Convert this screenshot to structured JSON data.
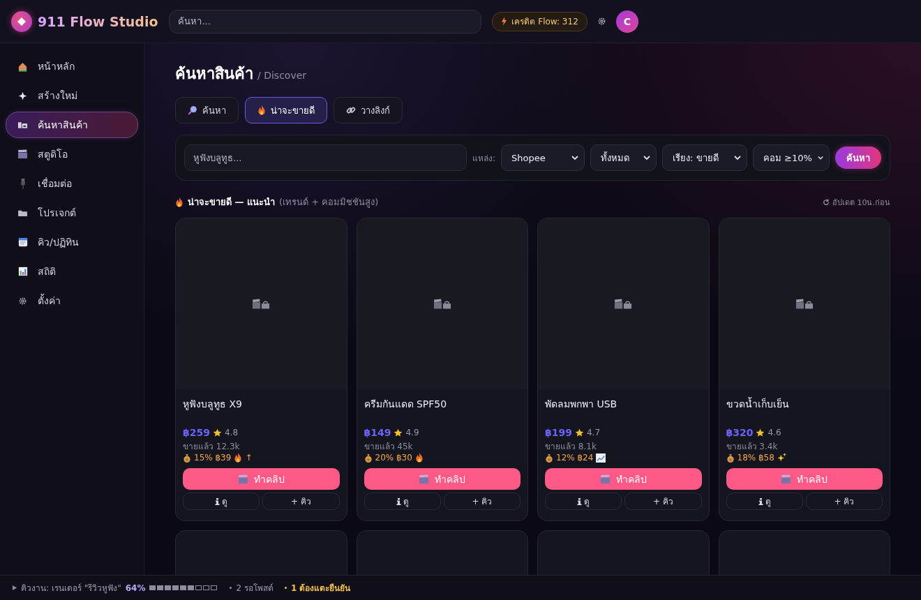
{
  "app": {
    "name": "911 Flow Studio",
    "search_placeholder": "ค้นหา...",
    "credits": "เครดิต Flow: 312",
    "avatar": "C"
  },
  "sidebar": {
    "items": [
      {
        "label": "หน้าหลัก",
        "selected": false
      },
      {
        "label": "สร้างใหม่",
        "selected": false
      },
      {
        "label": "ค้นหาสินค้า",
        "selected": true
      },
      {
        "label": "สตูดิโอ",
        "selected": false
      },
      {
        "label": "เชื่อมต่อ",
        "selected": false
      },
      {
        "label": "โปรเจกต์",
        "selected": false
      },
      {
        "label": "คิว/ปฏิทิน",
        "selected": false
      },
      {
        "label": "สถิติ",
        "selected": false
      },
      {
        "label": "ตั้งค่า",
        "selected": false
      }
    ]
  },
  "page": {
    "title": "ค้นหาสินค้า",
    "subtitle": "/ Discover"
  },
  "tabs": [
    {
      "label": "ค้นหา",
      "selected": false
    },
    {
      "label": "น่าจะขายดี",
      "selected": true
    },
    {
      "label": "วางลิงก์",
      "selected": false
    }
  ],
  "filters": {
    "query_placeholder": "หูฟังบลูทูธ...",
    "source_label": "แหล่ง:",
    "selects": [
      "Shopee",
      "ทั้งหมด",
      "เรียง: ขายดี",
      "คอม ≥10%"
    ],
    "search_button": "ค้นหา"
  },
  "section": {
    "title": "น่าจะขายดี — แนะนำ",
    "note": "(เทรนด์ + คอมมิชชันสูง)",
    "updated": "อัปเดต 10น.ก่อน"
  },
  "products": [
    {
      "name": "หูฟังบลูทูธ X9",
      "price": "฿259",
      "rating": "4.8",
      "sold": "ขายแล้ว 12.3k",
      "commission": "15% ฿39",
      "trend": "↑",
      "make_button": "ทำคลิป",
      "view_button": "ดู",
      "queue_button": "+ คิว"
    },
    {
      "name": "ครีมกันแดด SPF50",
      "price": "฿149",
      "rating": "4.9",
      "sold": "ขายแล้ว 45k",
      "commission": "20% ฿30",
      "make_button": "ทำคลิป",
      "view_button": "ดู",
      "queue_button": "+ คิว"
    },
    {
      "name": "พัดลมพกพา USB",
      "price": "฿199",
      "rating": "4.7",
      "sold": "ขายแล้ว 8.1k",
      "commission": "12% ฿24",
      "make_button": "ทำคลิป",
      "view_button": "ดู",
      "queue_button": "+ คิว"
    },
    {
      "name": "ขวดน้ำเก็บเย็น",
      "price": "฿320",
      "rating": "4.6",
      "sold": "ขายแล้ว 3.4k",
      "commission": "18% ฿58",
      "make_button": "ทำคลิป",
      "view_button": "ดู",
      "queue_button": "+ คิว"
    }
  ],
  "next_row": [
    {
      "kind": "placeholder"
    },
    {
      "kind": "placeholder"
    },
    {
      "kind": "placeholder"
    },
    {
      "kind": "placeholder"
    }
  ],
  "status_bar": {
    "job": "คิวงาน: เรนเดอร์ \"รีวิวหูฟัง\"",
    "percent": "64%",
    "level": 0.64,
    "waiting": "2 รอโพสต์",
    "confirm": "1 ต้องแตะยืนยัน"
  }
}
